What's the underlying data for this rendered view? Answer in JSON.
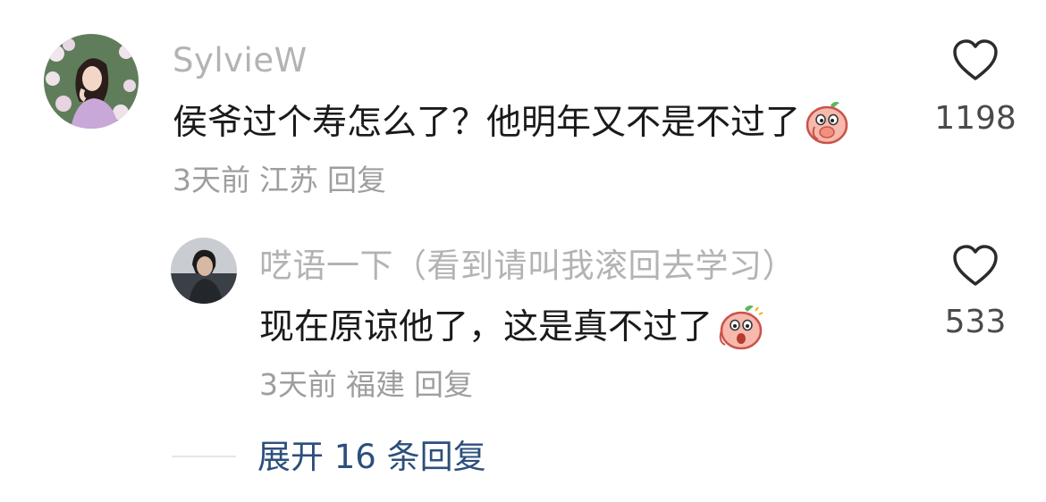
{
  "comments": [
    {
      "username": "SylvieW",
      "text": "侯爷过个寿怎么了？他明年又不是不过了",
      "time": "3天前",
      "location": "江苏",
      "reply_label": "回复",
      "likes": "1198",
      "emoji": "peach-emoji-icon"
    }
  ],
  "replies": [
    {
      "username": "呓语一下（看到请叫我滚回去学习）",
      "text": "现在原谅他了，这是真不过了",
      "time": "3天前",
      "location": "福建",
      "reply_label": "回复",
      "likes": "533",
      "emoji": "peach-shocked-emoji-icon"
    }
  ],
  "expand": {
    "label": "展开 16 条回复"
  },
  "colors": {
    "username": "#b3b3b3",
    "meta": "#9e9e9e",
    "link": "#2c4f7c",
    "text": "#1a1a1a"
  }
}
